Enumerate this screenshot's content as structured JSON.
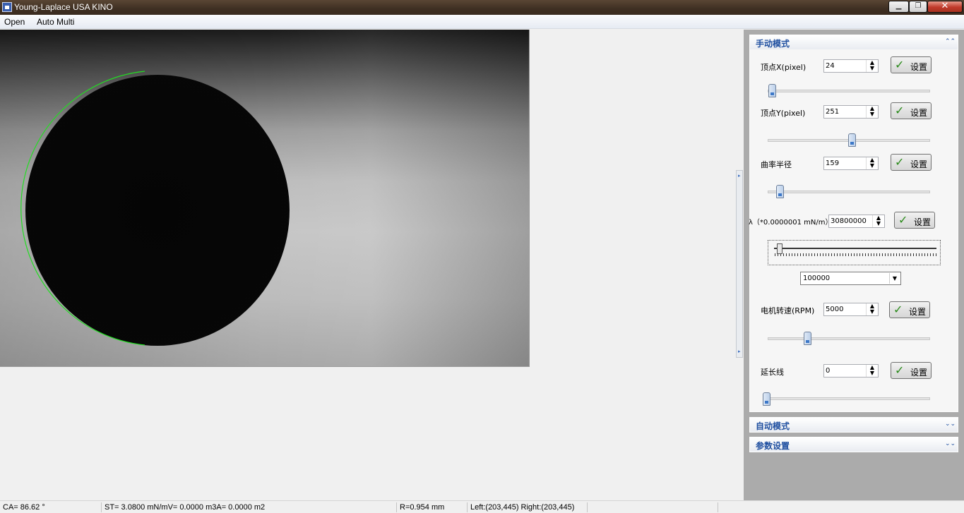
{
  "window": {
    "title": "Young-Laplace USA KINO"
  },
  "menu": {
    "items": [
      "Open",
      "Auto Multi"
    ]
  },
  "panel": {
    "manual": {
      "title": "手动模式",
      "vertex_x": {
        "label": "顶点X(pixel)",
        "value": "24",
        "button": "设置",
        "slider_fraction": 0.03
      },
      "vertex_y": {
        "label": "顶点Y(pixel)",
        "value": "251",
        "button": "设置",
        "slider_fraction": 0.52
      },
      "radius": {
        "label": "曲率半径",
        "value": "159",
        "button": "设置",
        "slider_fraction": 0.08
      },
      "lambda": {
        "label": "λ（*0.0000001 mN/m）",
        "value": "30800000",
        "button": "设置"
      },
      "scale": {
        "value": "100000"
      },
      "motor": {
        "label": "电机转速(RPM)",
        "value": "5000",
        "button": "设置",
        "slider_fraction": 0.25
      },
      "extension": {
        "label": "延长线",
        "value": "0",
        "button": "设置",
        "slider_fraction": 0.0
      }
    },
    "auto": {
      "title": "自动模式"
    },
    "params": {
      "title": "参数设置"
    }
  },
  "status": {
    "ca": "CA= 86.62  °",
    "st": "ST= 3.0800  mN/mV= 0.0000  m3A= 0.0000  m2",
    "r": "R=0.954 mm",
    "lr": "Left:(203,445)  Right:(203,445)",
    "extra": ""
  },
  "colors": {
    "fit_curve": "#22dd22",
    "group_title": "#1f4fa0",
    "check": "#2a8a1a"
  },
  "icons": {
    "collapse": "double-chevron-up-icon",
    "expand": "double-chevron-down-icon",
    "set": "checkmark-icon"
  }
}
